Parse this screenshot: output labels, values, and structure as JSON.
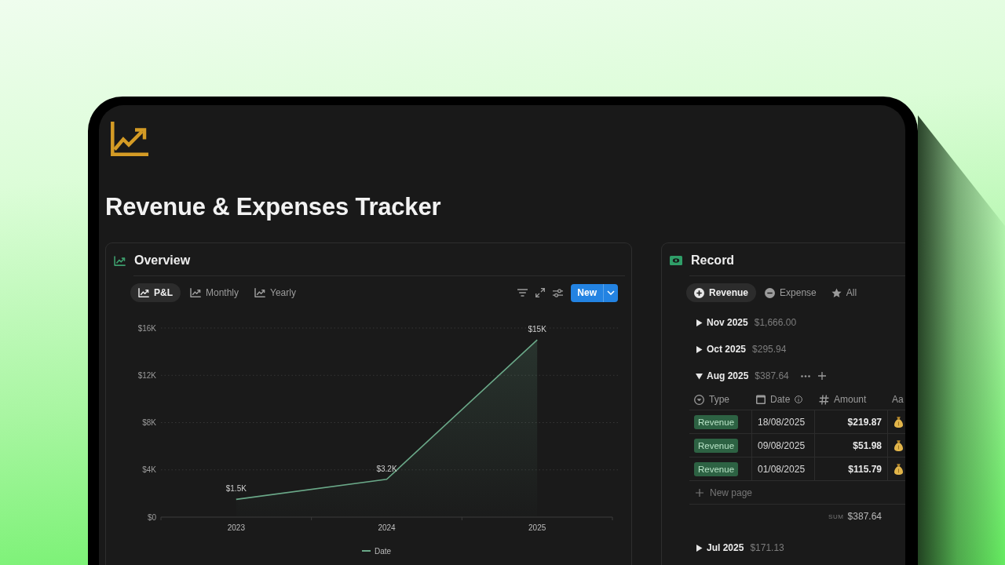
{
  "page": {
    "title": "Revenue & Expenses Tracker"
  },
  "overview": {
    "title": "Overview",
    "views": [
      {
        "label": "P&L",
        "selected": true
      },
      {
        "label": "Monthly",
        "selected": false
      },
      {
        "label": "Yearly",
        "selected": false
      }
    ],
    "new_button": "New",
    "chart_data": {
      "type": "area",
      "categories": [
        "2023",
        "2024",
        "2025"
      ],
      "series": [
        {
          "name": "Date",
          "color": "#6aa888",
          "values": [
            1500,
            3200,
            15000
          ]
        }
      ],
      "ylim": [
        0,
        16000
      ],
      "yticks": [
        {
          "value": 0,
          "label": "$0"
        },
        {
          "value": 4000,
          "label": "$4K"
        },
        {
          "value": 8000,
          "label": "$8K"
        },
        {
          "value": 12000,
          "label": "$12K"
        },
        {
          "value": 16000,
          "label": "$16K"
        }
      ],
      "grid": true,
      "value_labels": [
        "$1.5K",
        "$3.2K",
        "$15K"
      ]
    }
  },
  "record": {
    "title": "Record",
    "filters": [
      {
        "label": "Revenue",
        "kind": "plus",
        "selected": true
      },
      {
        "label": "Expense",
        "kind": "minus",
        "selected": false
      },
      {
        "label": "All",
        "kind": "star",
        "selected": false
      }
    ],
    "groups": [
      {
        "label": "Nov 2025",
        "total": "$1,666.00",
        "expanded": false,
        "hovered": false
      },
      {
        "label": "Oct 2025",
        "total": "$295.94",
        "expanded": false,
        "hovered": false
      },
      {
        "label": "Aug 2025",
        "total": "$387.64",
        "expanded": true,
        "hovered": true,
        "table": {
          "columns": [
            {
              "label": "Type",
              "kind": "select",
              "info": false
            },
            {
              "label": "Date",
              "kind": "date",
              "info": true
            },
            {
              "label": "Amount",
              "kind": "number",
              "info": false
            },
            {
              "label": "Aa",
              "kind": "title",
              "info": false
            }
          ],
          "rows": [
            {
              "type": "Revenue",
              "date": "18/08/2025",
              "amount": "$219.87"
            },
            {
              "type": "Revenue",
              "date": "09/08/2025",
              "amount": "$51.98"
            },
            {
              "type": "Revenue",
              "date": "01/08/2025",
              "amount": "$115.79"
            }
          ],
          "new_row": "New page",
          "sum_label": "SUM",
          "sum": "$387.64"
        }
      },
      {
        "label": "Jul 2025",
        "total": "$171.13",
        "expanded": false,
        "hovered": false
      }
    ]
  }
}
